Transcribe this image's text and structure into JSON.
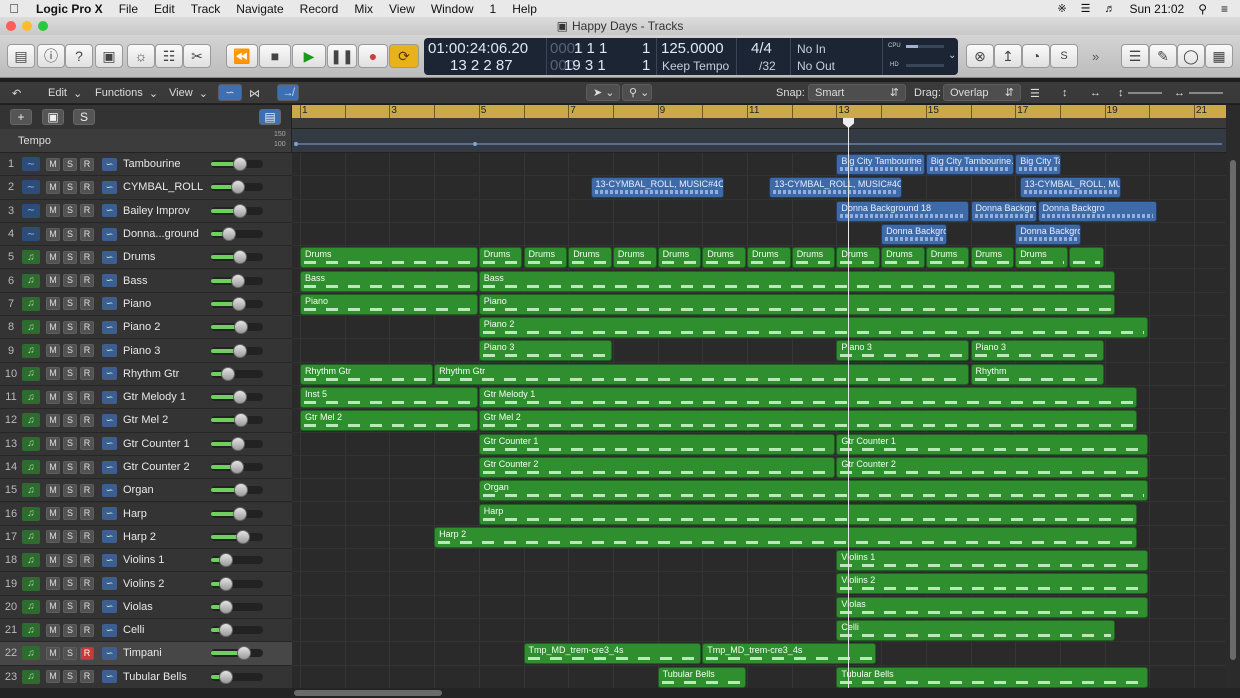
{
  "menubar": {
    "app_name": "Logic Pro X",
    "items": [
      "File",
      "Edit",
      "Track",
      "Navigate",
      "Record",
      "Mix",
      "View",
      "Window",
      "1",
      "Help"
    ],
    "clock": "Sun 21:02"
  },
  "window": {
    "title": "Happy Days - Tracks"
  },
  "lcd": {
    "position_time": "01:00:24:06.20",
    "position_time_sub": "13  2  2   87",
    "bars_main": "1   1   1",
    "bars_main_prefix": "0001",
    "bars_main_suffix": "1",
    "bars_sub": "19  3  1",
    "bars_sub_prefix": "000",
    "bars_sub_suffix": "1",
    "tempo": "125.0000",
    "tempo_mode": "Keep Tempo",
    "signature": "4/4",
    "division": "/32",
    "midi_in": "No In",
    "midi_out": "No Out",
    "cpu_label": "CPU",
    "hd_label": "HD"
  },
  "toolbar2": {
    "edit": "Edit",
    "functions": "Functions",
    "view": "View",
    "snap_label": "Snap:",
    "snap_value": "Smart",
    "drag_label": "Drag:",
    "drag_value": "Overlap"
  },
  "header": {
    "add": "+",
    "solo": "S",
    "tempo_label": "Tempo",
    "tempo_high": "150",
    "tempo_low": "100"
  },
  "ruler": {
    "bars": [
      "1",
      "3",
      "5",
      "7",
      "9",
      "11",
      "13",
      "15",
      "17",
      "19",
      "21"
    ]
  },
  "tracks": [
    {
      "num": "1",
      "name": "Tambourine",
      "type": "audio",
      "m": "M",
      "s": "S",
      "r": "R",
      "volume": 0.55
    },
    {
      "num": "2",
      "name": "CYMBAL_ROLL",
      "type": "audio",
      "m": "M",
      "s": "S",
      "r": "R",
      "volume": 0.5
    },
    {
      "num": "3",
      "name": "Bailey Improv",
      "type": "audio",
      "m": "M",
      "s": "S",
      "r": "R",
      "volume": 0.55
    },
    {
      "num": "4",
      "name": "Donna...ground",
      "type": "audio",
      "m": "M",
      "s": "S",
      "r": "R",
      "volume": 0.28
    },
    {
      "num": "5",
      "name": "Drums",
      "type": "midi",
      "m": "M",
      "s": "S",
      "r": "R",
      "volume": 0.55
    },
    {
      "num": "6",
      "name": "Bass",
      "type": "midi",
      "m": "M",
      "s": "S",
      "r": "R",
      "volume": 0.5
    },
    {
      "num": "7",
      "name": "Piano",
      "type": "midi",
      "m": "M",
      "s": "S",
      "r": "R",
      "volume": 0.52
    },
    {
      "num": "8",
      "name": "Piano 2",
      "type": "midi",
      "m": "M",
      "s": "S",
      "r": "R",
      "volume": 0.57
    },
    {
      "num": "9",
      "name": "Piano 3",
      "type": "midi",
      "m": "M",
      "s": "S",
      "r": "R",
      "volume": 0.55
    },
    {
      "num": "10",
      "name": "Rhythm Gtr",
      "type": "midi",
      "m": "M",
      "s": "S",
      "r": "R",
      "volume": 0.25
    },
    {
      "num": "11",
      "name": "Gtr Melody 1",
      "type": "midi",
      "m": "M",
      "s": "S",
      "r": "R",
      "volume": 0.55
    },
    {
      "num": "12",
      "name": "Gtr Mel 2",
      "type": "midi",
      "m": "M",
      "s": "S",
      "r": "R",
      "volume": 0.57
    },
    {
      "num": "13",
      "name": "Gtr Counter 1",
      "type": "midi",
      "m": "M",
      "s": "S",
      "r": "R",
      "volume": 0.5
    },
    {
      "num": "14",
      "name": "Gtr Counter 2",
      "type": "midi",
      "m": "M",
      "s": "S",
      "r": "R",
      "volume": 0.48
    },
    {
      "num": "15",
      "name": "Organ",
      "type": "midi",
      "m": "M",
      "s": "S",
      "r": "R",
      "volume": 0.57
    },
    {
      "num": "16",
      "name": "Harp",
      "type": "midi",
      "m": "M",
      "s": "S",
      "r": "R",
      "volume": 0.55
    },
    {
      "num": "17",
      "name": "Harp 2",
      "type": "midi",
      "m": "M",
      "s": "S",
      "r": "R",
      "volume": 0.62
    },
    {
      "num": "18",
      "name": "Violins 1",
      "type": "midi",
      "m": "M",
      "s": "S",
      "r": "R",
      "volume": 0.2
    },
    {
      "num": "19",
      "name": "Violins 2",
      "type": "midi",
      "m": "M",
      "s": "S",
      "r": "R",
      "volume": 0.2
    },
    {
      "num": "20",
      "name": "Violas",
      "type": "midi",
      "m": "M",
      "s": "S",
      "r": "R",
      "volume": 0.2
    },
    {
      "num": "21",
      "name": "Celli",
      "type": "midi",
      "m": "M",
      "s": "S",
      "r": "R",
      "volume": 0.2
    },
    {
      "num": "22",
      "name": "Timpani",
      "type": "midi",
      "m": "M",
      "s": "S",
      "r": "R",
      "volume": 0.65,
      "selected": true,
      "rec_armed": true
    },
    {
      "num": "23",
      "name": "Tubular Bells",
      "type": "midi",
      "m": "M",
      "s": "S",
      "r": "R",
      "volume": 0.2
    }
  ],
  "regions": [
    {
      "track": 0,
      "name": "Big City Tambourine",
      "type": "audio",
      "start": 13,
      "end": 15
    },
    {
      "track": 0,
      "name": "Big City Tambourine.",
      "type": "audio",
      "start": 15,
      "end": 17
    },
    {
      "track": 0,
      "name": "Big City Ta",
      "type": "audio",
      "start": 17,
      "end": 18.05
    },
    {
      "track": 1,
      "name": "13-CYMBAL_ROLL, MUSIC#4C",
      "type": "audio",
      "start": 7.5,
      "end": 10.5
    },
    {
      "track": 1,
      "name": "13-CYMBAL_ROLL, MUSIC#4C",
      "type": "audio",
      "start": 11.5,
      "end": 14.5
    },
    {
      "track": 1,
      "name": "13-CYMBAL_ROLL, MU",
      "type": "audio",
      "start": 17.1,
      "end": 19.4
    },
    {
      "track": 2,
      "name": "Donna Background 18",
      "type": "audio",
      "start": 13,
      "end": 16
    },
    {
      "track": 2,
      "name": "Donna Backgrd",
      "type": "audio",
      "start": 16,
      "end": 17.5
    },
    {
      "track": 2,
      "name": "Donna Backgro",
      "type": "audio",
      "start": 17.5,
      "end": 20.2
    },
    {
      "track": 3,
      "name": "Donna Backgro",
      "type": "audio",
      "start": 14,
      "end": 15.5
    },
    {
      "track": 3,
      "name": "Donna Backgro",
      "type": "audio",
      "start": 17,
      "end": 18.5
    },
    {
      "track": 4,
      "name": "Drums",
      "type": "midi",
      "start": 1,
      "end": 5
    },
    {
      "track": 4,
      "name": "Drums",
      "type": "midi",
      "start": 5,
      "end": 6
    },
    {
      "track": 4,
      "name": "Drums",
      "type": "midi",
      "start": 6,
      "end": 7
    },
    {
      "track": 4,
      "name": "Drums",
      "type": "midi",
      "start": 7,
      "end": 8
    },
    {
      "track": 4,
      "name": "Drums",
      "type": "midi",
      "start": 8,
      "end": 9
    },
    {
      "track": 4,
      "name": "Drums",
      "type": "midi",
      "start": 9,
      "end": 10
    },
    {
      "track": 4,
      "name": "Drums",
      "type": "midi",
      "start": 10,
      "end": 11
    },
    {
      "track": 4,
      "name": "Drums",
      "type": "midi",
      "start": 11,
      "end": 12
    },
    {
      "track": 4,
      "name": "Drums",
      "type": "midi",
      "start": 12,
      "end": 13
    },
    {
      "track": 4,
      "name": "Drums",
      "type": "midi",
      "start": 13,
      "end": 14
    },
    {
      "track": 4,
      "name": "Drums",
      "type": "midi",
      "start": 14,
      "end": 15
    },
    {
      "track": 4,
      "name": "Drums",
      "type": "midi",
      "start": 15,
      "end": 16
    },
    {
      "track": 4,
      "name": "Drums",
      "type": "midi",
      "start": 16,
      "end": 17
    },
    {
      "track": 4,
      "name": "Drums",
      "type": "midi",
      "start": 17,
      "end": 18.2
    },
    {
      "track": 4,
      "name": "",
      "type": "midi",
      "start": 18.2,
      "end": 19
    },
    {
      "track": 5,
      "name": "Bass",
      "type": "midi",
      "start": 1,
      "end": 5
    },
    {
      "track": 5,
      "name": "Bass",
      "type": "midi",
      "start": 5,
      "end": 19.25
    },
    {
      "track": 6,
      "name": "Piano",
      "type": "midi",
      "start": 1,
      "end": 5
    },
    {
      "track": 6,
      "name": "Piano",
      "type": "midi",
      "start": 5,
      "end": 19.25
    },
    {
      "track": 7,
      "name": "Piano 2",
      "type": "midi",
      "start": 5,
      "end": 20
    },
    {
      "track": 8,
      "name": "Piano 3",
      "type": "midi",
      "start": 5,
      "end": 8
    },
    {
      "track": 8,
      "name": "Piano 3",
      "type": "midi",
      "start": 13,
      "end": 16
    },
    {
      "track": 8,
      "name": "Piano 3",
      "type": "midi",
      "start": 16,
      "end": 19
    },
    {
      "track": 9,
      "name": "Rhythm Gtr",
      "type": "midi",
      "start": 1,
      "end": 4
    },
    {
      "track": 9,
      "name": "Rhythm Gtr",
      "type": "midi",
      "start": 4,
      "end": 16
    },
    {
      "track": 9,
      "name": "Rhythm",
      "type": "midi",
      "start": 16,
      "end": 19
    },
    {
      "track": 10,
      "name": "Inst 5",
      "type": "midi",
      "start": 1,
      "end": 5
    },
    {
      "track": 10,
      "name": "Gtr Melody 1",
      "type": "midi",
      "start": 5,
      "end": 19.75
    },
    {
      "track": 11,
      "name": "Gtr Mel 2",
      "type": "midi",
      "start": 1,
      "end": 5
    },
    {
      "track": 11,
      "name": "Gtr Mel 2",
      "type": "midi",
      "start": 5,
      "end": 19.75
    },
    {
      "track": 12,
      "name": "Gtr Counter 1",
      "type": "midi",
      "start": 5,
      "end": 13
    },
    {
      "track": 12,
      "name": "Gtr Counter 1",
      "type": "midi",
      "start": 13,
      "end": 20
    },
    {
      "track": 13,
      "name": "Gtr Counter 2",
      "type": "midi",
      "start": 5,
      "end": 13
    },
    {
      "track": 13,
      "name": "Gtr Counter 2",
      "type": "midi",
      "start": 13,
      "end": 20
    },
    {
      "track": 14,
      "name": "Organ",
      "type": "midi",
      "start": 5,
      "end": 20
    },
    {
      "track": 15,
      "name": "Harp",
      "type": "midi",
      "start": 5,
      "end": 19.75
    },
    {
      "track": 16,
      "name": "Harp 2",
      "type": "midi",
      "start": 4,
      "end": 19.75
    },
    {
      "track": 17,
      "name": "Violins 1",
      "type": "midi",
      "start": 13,
      "end": 20
    },
    {
      "track": 18,
      "name": "Violins 2",
      "type": "midi",
      "start": 13,
      "end": 20
    },
    {
      "track": 19,
      "name": "Violas",
      "type": "midi",
      "start": 13,
      "end": 20
    },
    {
      "track": 20,
      "name": "Celli",
      "type": "midi",
      "start": 13,
      "end": 19.25
    },
    {
      "track": 21,
      "name": "Tmp_MD_trem-cre3_4s",
      "type": "midi",
      "start": 6,
      "end": 10
    },
    {
      "track": 21,
      "name": "Tmp_MD_trem-cre3_4s",
      "type": "midi",
      "start": 10,
      "end": 13.9
    },
    {
      "track": 22,
      "name": "Tubular Bells",
      "type": "midi",
      "start": 9,
      "end": 11
    },
    {
      "track": 22,
      "name": "Tubular Bells",
      "type": "midi",
      "start": 13,
      "end": 20
    }
  ],
  "colors": {
    "midi_region": "#2f8f2f",
    "audio_region": "#3e6aa8",
    "ruler": "#c9a949",
    "play": "#2fb52f",
    "record": "#d23a3a",
    "cycle": "#e8b21a"
  }
}
